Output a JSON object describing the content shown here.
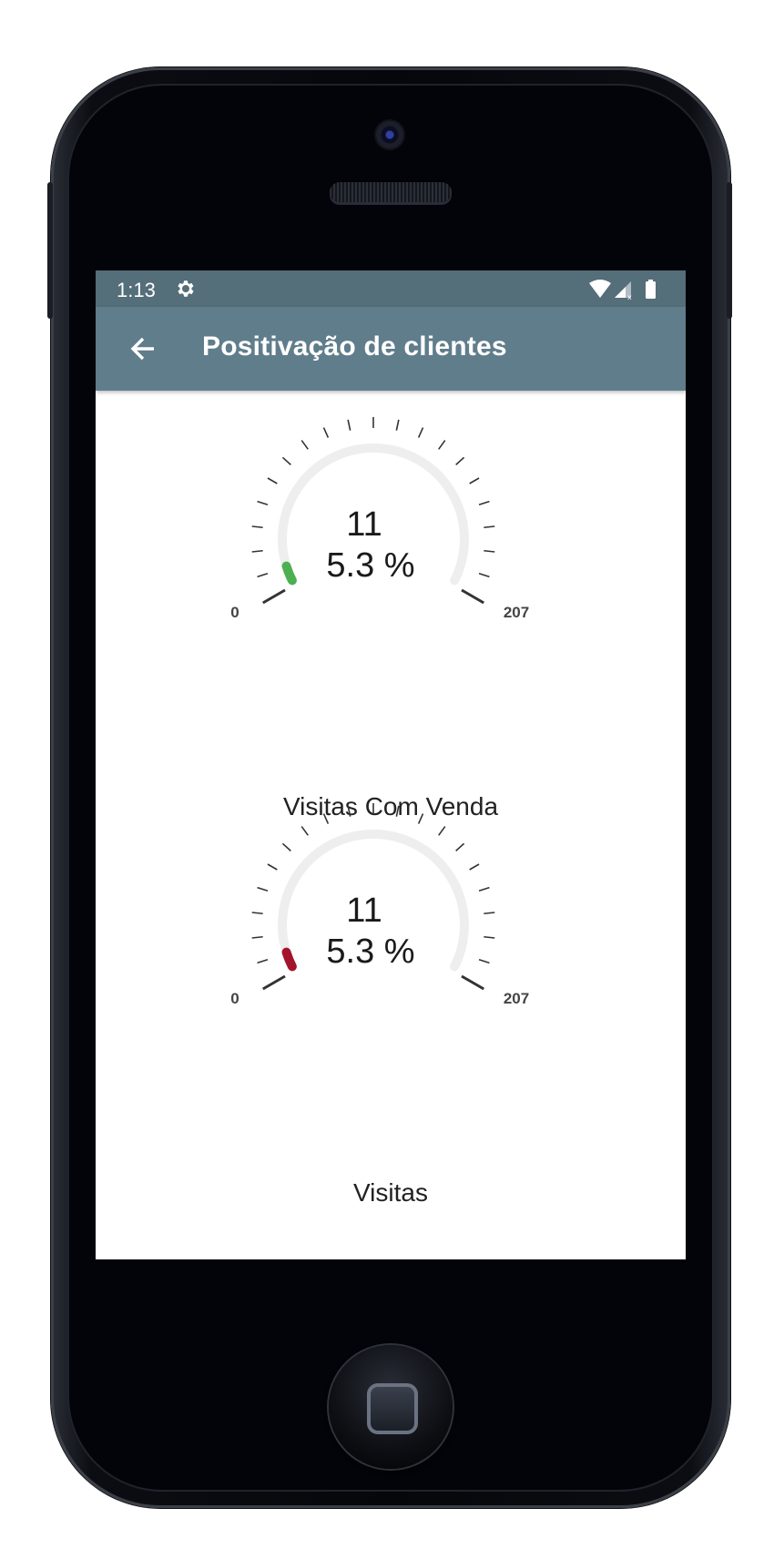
{
  "status_bar": {
    "time": "1:13",
    "icons": [
      "settings-gear-icon",
      "wifi-icon",
      "signal-icon",
      "battery-icon"
    ]
  },
  "app_bar": {
    "title": "Positivação de clientes",
    "back_icon": "arrow-back-icon"
  },
  "gauges": [
    {
      "value": "11",
      "percent": "5.3 %",
      "min": "0",
      "max": "207",
      "fraction": 0.053,
      "indicator_color": "#4caf50",
      "label": "Visitas Com Venda"
    },
    {
      "value": "11",
      "percent": "5.3 %",
      "min": "0",
      "max": "207",
      "fraction": 0.053,
      "indicator_color": "#a4132c",
      "label": "Visitas"
    }
  ],
  "nav_bar": {
    "items": [
      "back-triangle-icon",
      "home-circle-icon",
      "recents-square-icon"
    ]
  },
  "colors": {
    "status_bar": "#546e7a",
    "app_bar": "#607d8b",
    "gauge_track": "#eeeeee",
    "ticks": "#333333"
  }
}
